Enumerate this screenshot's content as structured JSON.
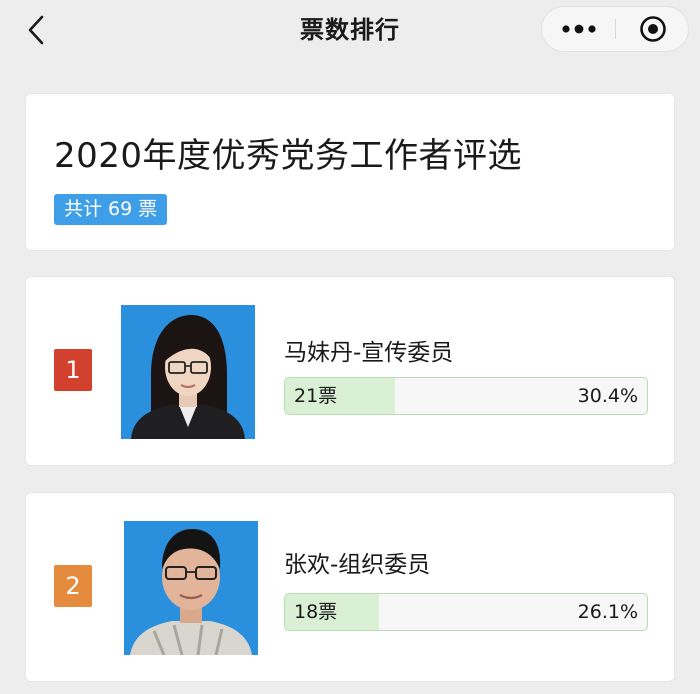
{
  "nav": {
    "title": "票数排行"
  },
  "icons": {
    "back": "chevron-left-icon",
    "more": "more-dots-icon",
    "close": "target-close-icon"
  },
  "poll": {
    "title": "2020年度优秀党务工作者评选",
    "total_label": "共计 69 票"
  },
  "candidates": [
    {
      "rank": "1",
      "name": "马妹丹-宣传委员",
      "votes_label": "21票",
      "percent_label": "30.4%",
      "fill_fraction": 0.304,
      "rank_color": "#d2412e"
    },
    {
      "rank": "2",
      "name": "张欢-组织委员",
      "votes_label": "18票",
      "percent_label": "26.1%",
      "fill_fraction": 0.261,
      "rank_color": "#e48b3d"
    }
  ],
  "colors": {
    "badge_blue": "#3e9ee8",
    "bar_fill": "#d9f0d5",
    "bar_border": "#b7dcb3",
    "photo_bg": "#2a8fdc"
  }
}
